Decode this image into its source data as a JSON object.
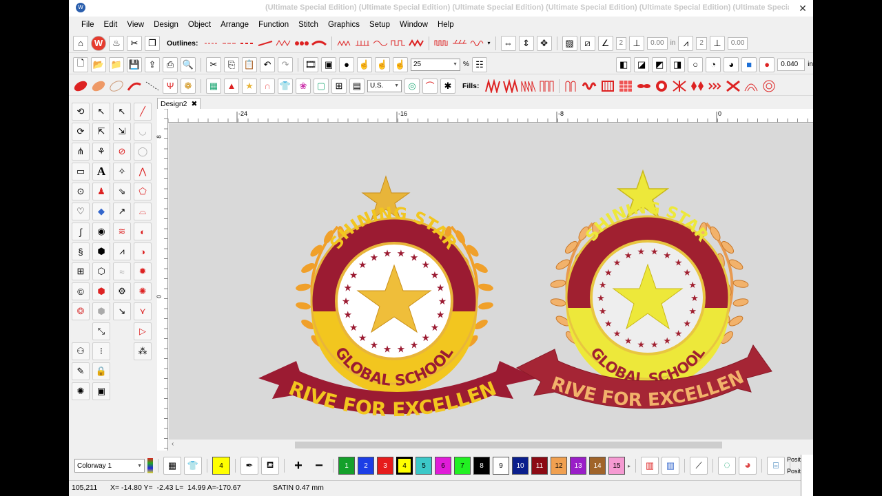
{
  "window": {
    "title": "(Ultimate Special Edition) (Ultimate Special Edition) (Ultimate Special Edition) (Ultimate Special Edition) (Ultimate Special Edition) (Ultimate Special Editi",
    "close_glyph": "✕"
  },
  "menu": [
    "File",
    "Edit",
    "View",
    "Design",
    "Object",
    "Arrange",
    "Function",
    "Stitch",
    "Graphics",
    "Setup",
    "Window",
    "Help"
  ],
  "toolbar1": {
    "outlines_label": "Outlines:",
    "spin1": "2",
    "spin2": "0.00",
    "in_label": "in",
    "spin3": "2",
    "spin4": "0.00"
  },
  "toolbar2": {
    "zoom_value": "25",
    "zoom_unit": "%",
    "width_value": "0.040",
    "width_unit": "in"
  },
  "toolbar3": {
    "units_value": "U.S.",
    "fills_label": "Fills:"
  },
  "tabs": [
    {
      "label": "Design2",
      "close": "✖"
    }
  ],
  "ruler": {
    "h_ticks": [
      "-24",
      "-16",
      "-8",
      "0"
    ],
    "v_ticks": [
      "8",
      "0"
    ]
  },
  "designs": [
    {
      "top_text": "SHINING STAR",
      "middle_text": "GLOBAL SCHOOL",
      "banner_text": "STRIVE FOR EXCELLENCE"
    },
    {
      "top_text": "SHINING STAR",
      "middle_text": "GLOBAL SCHOOL",
      "banner_text": "STRIVE FOR EXCELLENCE"
    }
  ],
  "colors": {
    "maroon": "#9b1b32",
    "yellow": "#f2c61f",
    "gold": "#e8b53a",
    "orange": "#f0a02a",
    "canvas": "#d9d9d9"
  },
  "colorway": {
    "selected": "Colorway 1",
    "current_swatch": "4"
  },
  "palette": [
    {
      "n": "1",
      "c": "#14a02a"
    },
    {
      "n": "2",
      "c": "#1c3ee6"
    },
    {
      "n": "3",
      "c": "#e61c1c"
    },
    {
      "n": "4",
      "c": "#ffff00"
    },
    {
      "n": "5",
      "c": "#3cc8c8"
    },
    {
      "n": "6",
      "c": "#e01cd8"
    },
    {
      "n": "7",
      "c": "#22f022"
    },
    {
      "n": "8",
      "c": "#000000"
    },
    {
      "n": "9",
      "c": "#ffffff"
    },
    {
      "n": "10",
      "c": "#0a1e8c"
    },
    {
      "n": "11",
      "c": "#8c0a14"
    },
    {
      "n": "12",
      "c": "#f0a050"
    },
    {
      "n": "13",
      "c": "#9a1ec8"
    },
    {
      "n": "14",
      "c": "#a0642a"
    },
    {
      "n": "15",
      "c": "#f59ad2"
    }
  ],
  "side_labels": [
    "Positi",
    "Positi"
  ],
  "status": {
    "coords": "105,211",
    "xy": "X= -14.80 Y=  -2.43 L=  14.99 A=-170.67",
    "stitch": "SATIN  0.47 mm"
  }
}
